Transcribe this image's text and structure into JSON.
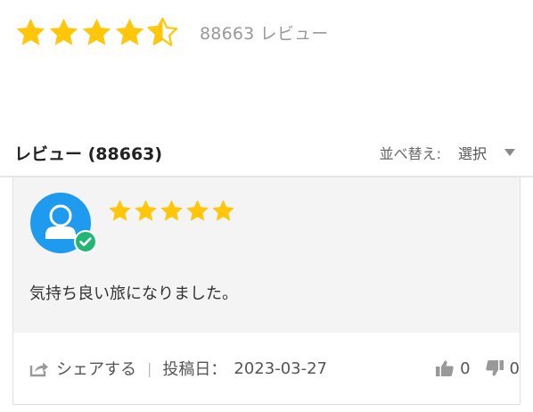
{
  "rating_summary": {
    "rating": 4.5,
    "max_stars": 5,
    "count_text": "88663 レビュー"
  },
  "reviews_header": {
    "title": "レビュー (88663)",
    "sort_label": "並べ替え:",
    "sort_value": "選択"
  },
  "review": {
    "rating": 5,
    "verified": true,
    "text": "気持ち良い旅になりました。",
    "share_label": "シェアする",
    "separator": "|",
    "posted_label": "投稿日：",
    "posted_date": "2023-03-27",
    "likes": "0",
    "dislikes": "0"
  },
  "colors": {
    "star": "#ffc60a",
    "avatar": "#1e9aef",
    "verified": "#22b573",
    "icon_gray": "#999999"
  },
  "icons": {
    "star": "star-icon",
    "half_star": "half-star-icon",
    "avatar": "user-avatar-icon",
    "verified": "verified-check-icon",
    "share": "share-icon",
    "thumbs_up": "thumbs-up-icon",
    "thumbs_down": "thumbs-down-icon",
    "caret": "caret-down-icon"
  }
}
